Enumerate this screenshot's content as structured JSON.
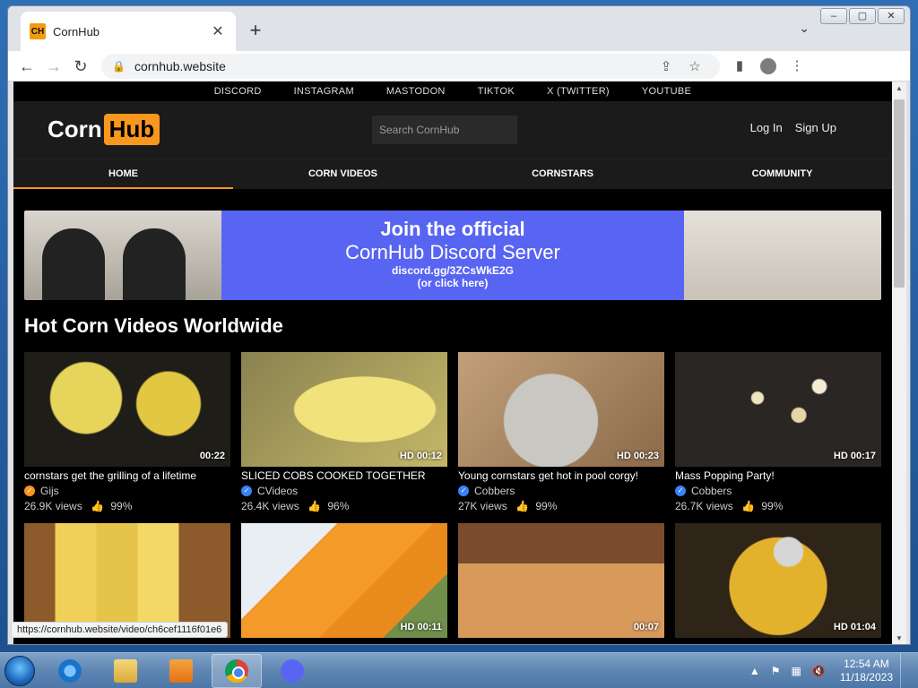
{
  "browser": {
    "tab_title": "CornHub",
    "tab_favicon_text": "CH",
    "new_tab_glyph": "+",
    "close_glyph": "✕",
    "url": "cornhub.website",
    "status_url": "https://cornhub.website/video/ch6cef1116f01e6"
  },
  "site": {
    "social_links": [
      "DISCORD",
      "INSTAGRAM",
      "MASTODON",
      "TIKTOK",
      "X (TWITTER)",
      "YOUTUBE"
    ],
    "logo_left": "Corn",
    "logo_right": "Hub",
    "search_placeholder": "Search CornHub",
    "login": "Log In",
    "signup": "Sign Up",
    "nav": [
      "HOME",
      "CORN VIDEOS",
      "CORNSTARS",
      "COMMUNITY"
    ],
    "banner": {
      "line1": "Join the official",
      "line2": "CornHub Discord Server",
      "line3": "discord.gg/3ZCsWkE2G",
      "line4": "(or click here)"
    },
    "section_title": "Hot Corn Videos Worldwide",
    "videos": [
      {
        "duration": "00:22",
        "title": "cornstars get the grilling of a lifetime",
        "author": "Gijs",
        "views": "26.9K views",
        "rating": "99%",
        "badge_color": "#f7971d"
      },
      {
        "duration": "HD 00:12",
        "title": "SLICED COBS COOKED TOGETHER",
        "author": "CVideos",
        "views": "26.4K views",
        "rating": "96%",
        "badge_color": "#3b82f6"
      },
      {
        "duration": "HD 00:23",
        "title": "Young cornstars get hot in pool corgy!",
        "author": "Cobbers",
        "views": "27K views",
        "rating": "99%",
        "badge_color": "#3b82f6"
      },
      {
        "duration": "HD 00:17",
        "title": "Mass Popping Party!",
        "author": "Cobbers",
        "views": "26.7K views",
        "rating": "99%",
        "badge_color": "#3b82f6"
      },
      {
        "duration": "",
        "title": "",
        "author": "",
        "views": "",
        "rating": ""
      },
      {
        "duration": "HD 00:11",
        "title": "",
        "author": "",
        "views": "",
        "rating": ""
      },
      {
        "duration": "00:07",
        "title": "",
        "author": "",
        "views": "",
        "rating": ""
      },
      {
        "duration": "HD 01:04",
        "title": "",
        "author": "",
        "views": "",
        "rating": ""
      }
    ]
  },
  "taskbar": {
    "time": "12:54 AM",
    "date": "11/18/2023"
  },
  "colors": {
    "accent": "#f7971d",
    "discord": "#5865f2"
  }
}
